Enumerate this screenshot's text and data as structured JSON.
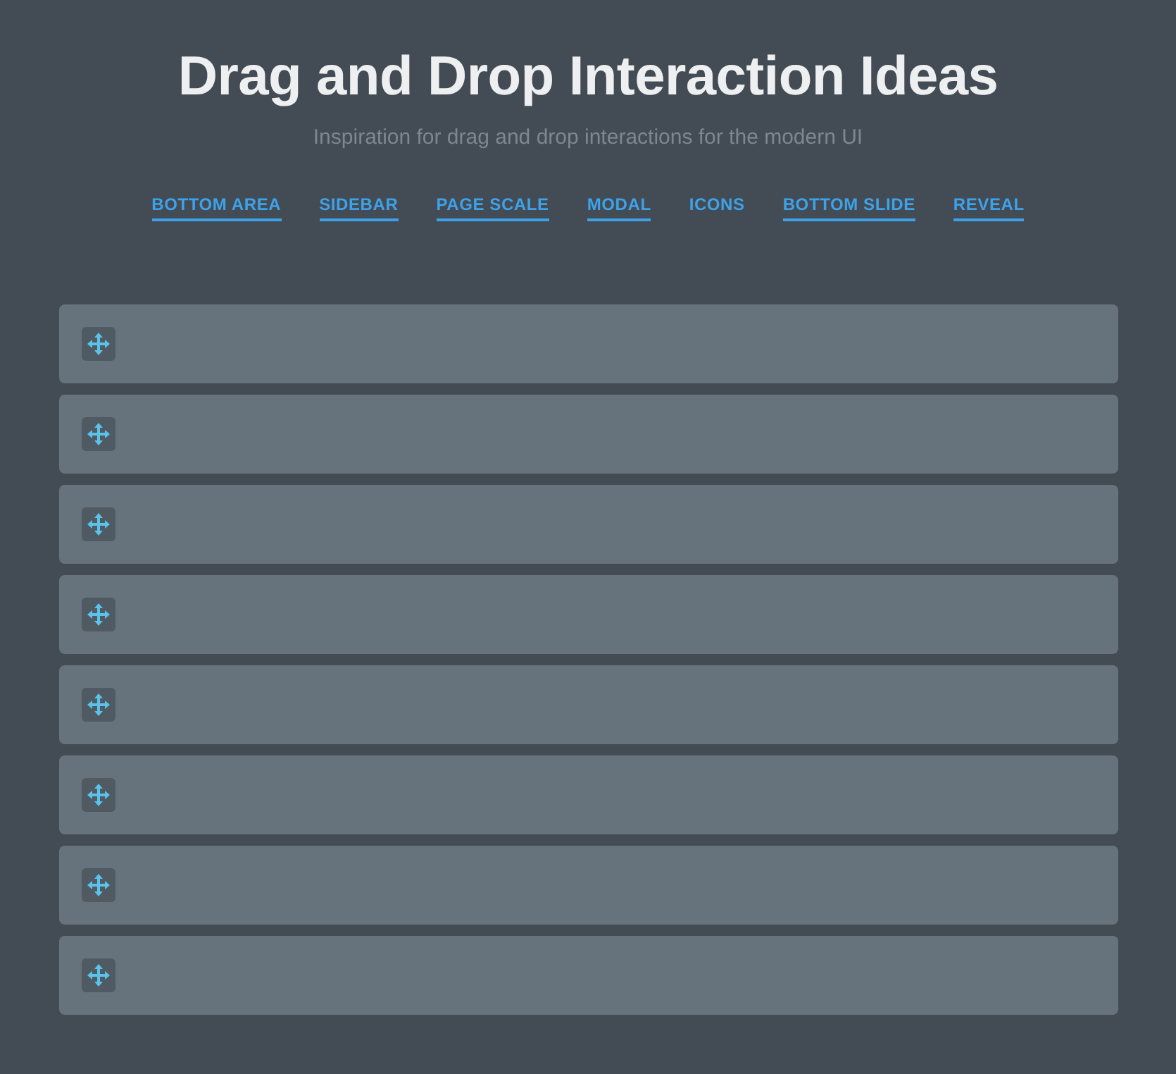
{
  "header": {
    "title": "Drag and Drop Interaction Ideas",
    "subtitle": "Inspiration for drag and drop interactions for the modern UI"
  },
  "nav": [
    {
      "label": "BOTTOM AREA",
      "selected": false
    },
    {
      "label": "SIDEBAR",
      "selected": false
    },
    {
      "label": "PAGE SCALE",
      "selected": false
    },
    {
      "label": "MODAL",
      "selected": false
    },
    {
      "label": "ICONS",
      "selected": true
    },
    {
      "label": "BOTTOM SLIDE",
      "selected": false
    },
    {
      "label": "REVEAL",
      "selected": false
    }
  ],
  "items": [
    {
      "kind": "draggable"
    },
    {
      "kind": "draggable"
    },
    {
      "kind": "draggable"
    },
    {
      "kind": "draggable"
    },
    {
      "kind": "draggable"
    },
    {
      "kind": "draggable"
    },
    {
      "kind": "draggable"
    },
    {
      "kind": "draggable"
    }
  ]
}
